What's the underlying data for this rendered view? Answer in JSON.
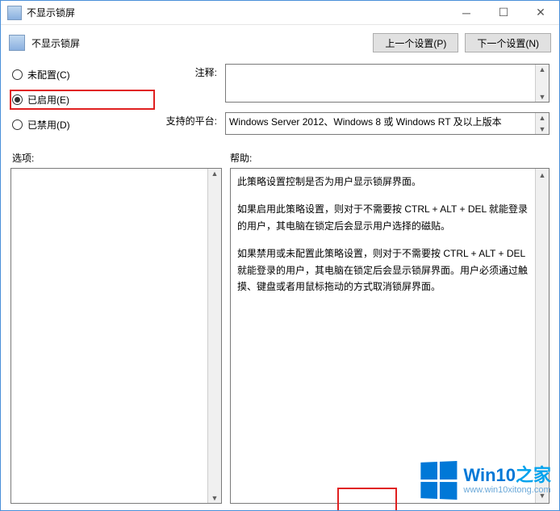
{
  "window": {
    "title": "不显示锁屏"
  },
  "toolbar": {
    "policy_name": "不显示锁屏",
    "prev_btn": "上一个设置(P)",
    "next_btn": "下一个设置(N)"
  },
  "radios": {
    "not_configured": "未配置(C)",
    "enabled": "已启用(E)",
    "disabled": "已禁用(D)",
    "selected": "enabled"
  },
  "rows": {
    "comment_label": "注释:",
    "comment_value": "",
    "platform_label": "支持的平台:",
    "platform_value": "Windows Server 2012、Windows 8 或 Windows RT 及以上版本"
  },
  "sections": {
    "options_label": "选项:",
    "help_label": "帮助:"
  },
  "help_paragraphs": [
    "此策略设置控制是否为用户显示锁屏界面。",
    "如果启用此策略设置，则对于不需要按 CTRL + ALT + DEL 就能登录的用户，其电脑在锁定后会显示用户选择的磁贴。",
    "如果禁用或未配置此策略设置，则对于不需要按 CTRL + ALT + DEL 就能登录的用户，其电脑在锁定后会显示锁屏界面。用户必须通过触摸、键盘或者用鼠标拖动的方式取消锁屏界面。"
  ],
  "watermark": {
    "brand_main": "Win10",
    "brand_suffix": "之家",
    "url": "www.win10xitong.com"
  }
}
